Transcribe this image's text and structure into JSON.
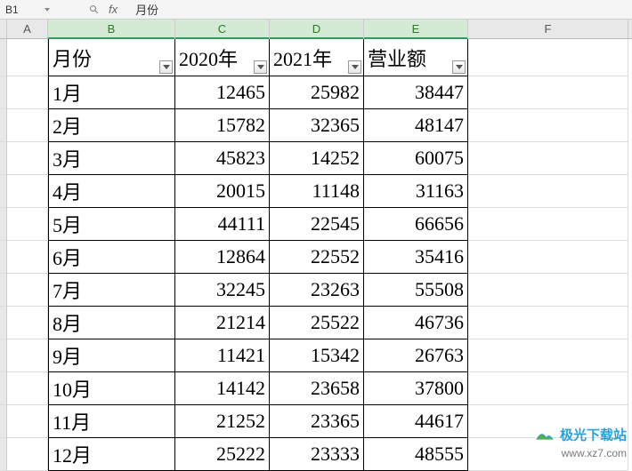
{
  "name_box": "B1",
  "formula_bar": "月份",
  "columns": [
    "A",
    "B",
    "C",
    "D",
    "E",
    "F"
  ],
  "selected_cols": [
    "B",
    "C",
    "D",
    "E"
  ],
  "table": {
    "headers": [
      "月份",
      "2020年",
      "2021年",
      "营业额"
    ],
    "rows": [
      {
        "month": "1月",
        "y2020": "12465",
        "y2021": "25982",
        "total": "38447"
      },
      {
        "month": "2月",
        "y2020": "15782",
        "y2021": "32365",
        "total": "48147"
      },
      {
        "month": "3月",
        "y2020": "45823",
        "y2021": "14252",
        "total": "60075"
      },
      {
        "month": "4月",
        "y2020": "20015",
        "y2021": "11148",
        "total": "31163"
      },
      {
        "month": "5月",
        "y2020": "44111",
        "y2021": "22545",
        "total": "66656"
      },
      {
        "month": "6月",
        "y2020": "12864",
        "y2021": "22552",
        "total": "35416"
      },
      {
        "month": "7月",
        "y2020": "32245",
        "y2021": "23263",
        "total": "55508"
      },
      {
        "month": "8月",
        "y2020": "21214",
        "y2021": "25522",
        "total": "46736"
      },
      {
        "month": "9月",
        "y2020": "11421",
        "y2021": "15342",
        "total": "26763"
      },
      {
        "month": "10月",
        "y2020": "14142",
        "y2021": "23658",
        "total": "37800"
      },
      {
        "month": "11月",
        "y2020": "21252",
        "y2021": "23365",
        "total": "44617"
      },
      {
        "month": "12月",
        "y2020": "25222",
        "y2021": "23333",
        "total": "48555"
      }
    ]
  },
  "watermark": {
    "title": "极光下载站",
    "url": "www.xz7.com"
  }
}
